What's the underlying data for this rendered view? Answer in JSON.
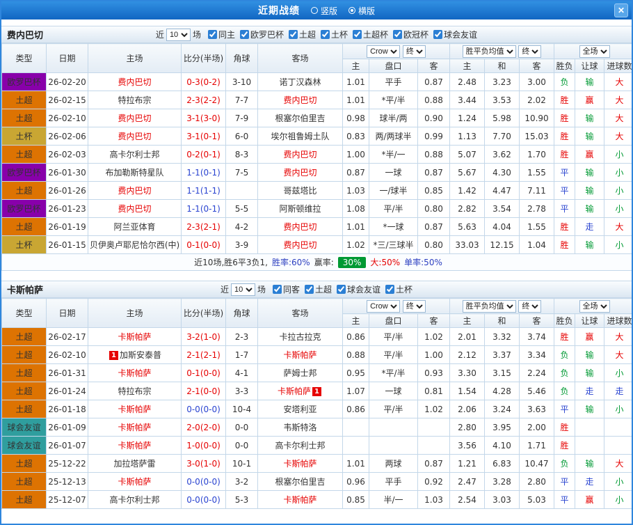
{
  "titlebar": {
    "title": "近期战绩",
    "radio_vertical": "竖版",
    "radio_horizontal": "横版",
    "close": "✕"
  },
  "colors": {
    "win": "#e60000",
    "draw": "#2943d0",
    "loss": "#009933",
    "focus_team": "#e60000",
    "badge_bg": "#009933",
    "type": {
      "欧罗巴杯": "#8800aa",
      "土超": "#dd7302",
      "土杯": "#c9a633",
      "土超杯": "#c9a633",
      "欧冠杯": "#8800aa",
      "球会友谊": "#2f9e9e"
    }
  },
  "header_labels": {
    "cols": [
      "类型",
      "日期",
      "主场",
      "比分(半场)",
      "角球",
      "客场"
    ],
    "bookmaker": "Crow",
    "odds_final": "终",
    "avg": "胜平负均值",
    "avg_final": "终",
    "scope": "全场",
    "sub": [
      "主",
      "盘口",
      "客",
      "主",
      "和",
      "客",
      "胜负",
      "让球",
      "进球数"
    ]
  },
  "sections": [
    {
      "team": "费内巴切",
      "filter": {
        "near": "近",
        "count": "10",
        "unit": "场",
        "checks": [
          "同主",
          "欧罗巴杯",
          "土超",
          "土杯",
          "土超杯",
          "欧冠杯",
          "球会友谊"
        ]
      },
      "rows": [
        {
          "type": "欧罗巴杯",
          "date": "26-02-20",
          "home": "费内巴切",
          "hf": 1,
          "score": "0-3(0-2)",
          "corner": "3-10",
          "away": "诺丁汉森林",
          "o": [
            "1.01",
            "平手",
            "0.87"
          ],
          "avg": [
            "2.48",
            "3.23",
            "3.00"
          ],
          "res": [
            "负",
            "输",
            "大"
          ]
        },
        {
          "type": "土超",
          "date": "26-02-15",
          "home": "特拉布宗",
          "score": "2-3(2-2)",
          "corner": "7-7",
          "away": "费内巴切",
          "af": 1,
          "o": [
            "1.01",
            "*平/半",
            "0.88"
          ],
          "avg": [
            "3.44",
            "3.53",
            "2.02"
          ],
          "res": [
            "胜",
            "赢",
            "大"
          ]
        },
        {
          "type": "土超",
          "date": "26-02-10",
          "home": "费内巴切",
          "hf": 1,
          "score": "3-1(3-0)",
          "corner": "7-9",
          "away": "根塞尔伯里吉",
          "o": [
            "0.98",
            "球半/两",
            "0.90"
          ],
          "avg": [
            "1.24",
            "5.98",
            "10.90"
          ],
          "res": [
            "胜",
            "输",
            "大"
          ]
        },
        {
          "type": "土杯",
          "date": "26-02-06",
          "home": "费内巴切",
          "hf": 1,
          "score": "3-1(0-1)",
          "corner": "6-0",
          "away": "埃尔祖鲁姆土队",
          "o": [
            "0.83",
            "两/两球半",
            "0.99"
          ],
          "avg": [
            "1.13",
            "7.70",
            "15.03"
          ],
          "res": [
            "胜",
            "输",
            "大"
          ]
        },
        {
          "type": "土超",
          "date": "26-02-03",
          "home": "高卡尔利士邦",
          "score": "0-2(0-1)",
          "corner": "8-3",
          "away": "费内巴切",
          "af": 1,
          "o": [
            "1.00",
            "*半/一",
            "0.88"
          ],
          "avg": [
            "5.07",
            "3.62",
            "1.70"
          ],
          "res": [
            "胜",
            "赢",
            "小"
          ]
        },
        {
          "type": "欧罗巴杯",
          "date": "26-01-30",
          "home": "布加勒斯特星队",
          "score": "1-1(0-1)",
          "corner": "7-5",
          "away": "费内巴切",
          "af": 1,
          "o": [
            "0.87",
            "一球",
            "0.87"
          ],
          "avg": [
            "5.67",
            "4.30",
            "1.55"
          ],
          "res": [
            "平",
            "输",
            "小"
          ]
        },
        {
          "type": "土超",
          "date": "26-01-26",
          "home": "费内巴切",
          "hf": 1,
          "score": "1-1(1-1)",
          "corner": "",
          "away": "哥兹塔比",
          "o": [
            "1.03",
            "一/球半",
            "0.85"
          ],
          "avg": [
            "1.42",
            "4.47",
            "7.11"
          ],
          "res": [
            "平",
            "输",
            "小"
          ]
        },
        {
          "type": "欧罗巴杯",
          "date": "26-01-23",
          "home": "费内巴切",
          "hf": 1,
          "score": "1-1(0-1)",
          "corner": "5-5",
          "away": "阿斯顿维拉",
          "o": [
            "1.08",
            "平/半",
            "0.80"
          ],
          "avg": [
            "2.82",
            "3.54",
            "2.78"
          ],
          "res": [
            "平",
            "输",
            "小"
          ]
        },
        {
          "type": "土超",
          "date": "26-01-19",
          "home": "阿兰亚体育",
          "score": "2-3(2-1)",
          "corner": "4-2",
          "away": "费内巴切",
          "af": 1,
          "o": [
            "1.01",
            "*一球",
            "0.87"
          ],
          "avg": [
            "5.63",
            "4.04",
            "1.55"
          ],
          "res": [
            "胜",
            "走",
            "大"
          ]
        },
        {
          "type": "土杯",
          "date": "26-01-15",
          "home": "贝伊奥卢耶尼恰尔西(中)",
          "score": "0-1(0-0)",
          "corner": "3-9",
          "away": "费内巴切",
          "af": 1,
          "o": [
            "1.02",
            "*三/三球半",
            "0.80"
          ],
          "avg": [
            "33.03",
            "12.15",
            "1.04"
          ],
          "res": [
            "胜",
            "输",
            "小"
          ]
        }
      ],
      "summary": [
        {
          "t": "近10场,胜6平3负1,",
          "c": "#333333"
        },
        {
          "t": "胜率:60%",
          "c": "#2c3fc0"
        },
        {
          "t": "赢率:",
          "c": "#333333"
        },
        {
          "t": "30%",
          "badge": true
        },
        {
          "t": "大:50%",
          "c": "#e60000"
        },
        {
          "t": "单率:50%",
          "c": "#2c3fc0"
        }
      ]
    },
    {
      "team": "卡斯帕萨",
      "filter": {
        "near": "近",
        "count": "10",
        "unit": "场",
        "checks": [
          "同客",
          "土超",
          "球会友谊",
          "土杯"
        ]
      },
      "rows": [
        {
          "type": "土超",
          "date": "26-02-17",
          "home": "卡斯帕萨",
          "hf": 1,
          "score": "3-2(1-0)",
          "corner": "2-3",
          "away": "卡拉古拉克",
          "o": [
            "0.86",
            "平/半",
            "1.02"
          ],
          "avg": [
            "2.01",
            "3.32",
            "3.74"
          ],
          "res": [
            "胜",
            "赢",
            "大"
          ]
        },
        {
          "type": "土超",
          "date": "26-02-10",
          "home": "加斯安泰普",
          "hcard": "1",
          "hcpos": "l",
          "score": "2-1(2-1)",
          "corner": "1-7",
          "away": "卡斯帕萨",
          "af": 1,
          "o": [
            "0.88",
            "平/半",
            "1.00"
          ],
          "avg": [
            "2.12",
            "3.37",
            "3.34"
          ],
          "res": [
            "负",
            "输",
            "大"
          ]
        },
        {
          "type": "土超",
          "date": "26-01-31",
          "home": "卡斯帕萨",
          "hf": 1,
          "score": "0-1(0-0)",
          "corner": "4-1",
          "away": "萨姆士邦",
          "o": [
            "0.95",
            "*平/半",
            "0.93"
          ],
          "avg": [
            "3.30",
            "3.15",
            "2.24"
          ],
          "res": [
            "负",
            "输",
            "小"
          ]
        },
        {
          "type": "土超",
          "date": "26-01-24",
          "home": "特拉布宗",
          "score": "2-1(0-0)",
          "corner": "3-3",
          "away": "卡斯帕萨",
          "af": 1,
          "acard": "1",
          "acpos": "r",
          "o": [
            "1.07",
            "一球",
            "0.81"
          ],
          "avg": [
            "1.54",
            "4.28",
            "5.46"
          ],
          "res": [
            "负",
            "走",
            "走"
          ]
        },
        {
          "type": "土超",
          "date": "26-01-18",
          "home": "卡斯帕萨",
          "hf": 1,
          "score": "0-0(0-0)",
          "corner": "10-4",
          "away": "安塔利亚",
          "o": [
            "0.86",
            "平/半",
            "1.02"
          ],
          "avg": [
            "2.06",
            "3.24",
            "3.63"
          ],
          "res": [
            "平",
            "输",
            "小"
          ]
        },
        {
          "type": "球会友谊",
          "date": "26-01-09",
          "home": "卡斯帕萨",
          "hf": 1,
          "score": "2-0(2-0)",
          "corner": "0-0",
          "away": "韦斯特洛",
          "o": [
            "",
            "",
            ""
          ],
          "avg": [
            "2.80",
            "3.95",
            "2.00"
          ],
          "res": [
            "胜",
            "",
            ""
          ]
        },
        {
          "type": "球会友谊",
          "date": "26-01-07",
          "home": "卡斯帕萨",
          "hf": 1,
          "score": "1-0(0-0)",
          "corner": "0-0",
          "away": "高卡尔利士邦",
          "o": [
            "",
            "",
            ""
          ],
          "avg": [
            "3.56",
            "4.10",
            "1.71"
          ],
          "res": [
            "胜",
            "",
            ""
          ]
        },
        {
          "type": "土超",
          "date": "25-12-22",
          "home": "加拉塔萨雷",
          "score": "3-0(1-0)",
          "corner": "10-1",
          "away": "卡斯帕萨",
          "af": 1,
          "o": [
            "1.01",
            "两球",
            "0.87"
          ],
          "avg": [
            "1.21",
            "6.83",
            "10.47"
          ],
          "res": [
            "负",
            "输",
            "大"
          ]
        },
        {
          "type": "土超",
          "date": "25-12-13",
          "home": "卡斯帕萨",
          "hf": 1,
          "score": "0-0(0-0)",
          "corner": "3-2",
          "away": "根塞尔伯里吉",
          "o": [
            "0.96",
            "平手",
            "0.92"
          ],
          "avg": [
            "2.47",
            "3.28",
            "2.80"
          ],
          "res": [
            "平",
            "走",
            "小"
          ]
        },
        {
          "type": "土超",
          "date": "25-12-07",
          "home": "高卡尔利士邦",
          "score": "0-0(0-0)",
          "corner": "5-3",
          "away": "卡斯帕萨",
          "af": 1,
          "o": [
            "0.85",
            "半/一",
            "1.03"
          ],
          "avg": [
            "2.54",
            "3.03",
            "5.03"
          ],
          "res": [
            "平",
            "赢",
            "小"
          ]
        }
      ],
      "summary": []
    }
  ]
}
